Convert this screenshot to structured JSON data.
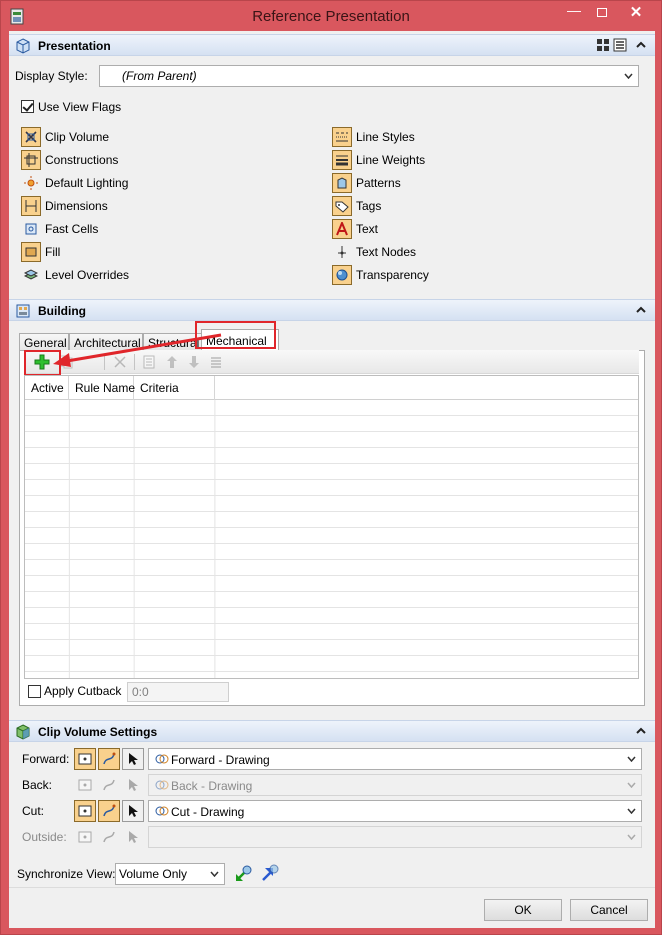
{
  "window": {
    "title": "Reference Presentation"
  },
  "presentation": {
    "title": "Presentation",
    "display_style_label": "Display Style:",
    "display_style_value": "(From Parent)",
    "use_view_flags_label": "Use View Flags",
    "use_view_flags_checked": true,
    "flags_left": [
      {
        "label": "Clip Volume",
        "icon": "clip-volume-icon"
      },
      {
        "label": "Constructions",
        "icon": "constructions-icon"
      },
      {
        "label": "Default Lighting",
        "icon": "default-lighting-icon"
      },
      {
        "label": "Dimensions",
        "icon": "dimensions-icon"
      },
      {
        "label": "Fast Cells",
        "icon": "fast-cells-icon"
      },
      {
        "label": "Fill",
        "icon": "fill-icon"
      },
      {
        "label": "Level Overrides",
        "icon": "level-overrides-icon"
      }
    ],
    "flags_right": [
      {
        "label": "Line Styles",
        "icon": "line-styles-icon"
      },
      {
        "label": "Line Weights",
        "icon": "line-weights-icon"
      },
      {
        "label": "Patterns",
        "icon": "patterns-icon"
      },
      {
        "label": "Tags",
        "icon": "tags-icon"
      },
      {
        "label": "Text",
        "icon": "text-icon"
      },
      {
        "label": "Text Nodes",
        "icon": "text-nodes-icon"
      },
      {
        "label": "Transparency",
        "icon": "transparency-icon"
      }
    ]
  },
  "building": {
    "title": "Building",
    "tabs": [
      {
        "label": "General"
      },
      {
        "label": "Architectural"
      },
      {
        "label": "Structural"
      },
      {
        "label": "Mechanical",
        "active": true
      }
    ],
    "columns": [
      "Active",
      "Rule Name",
      "Criteria"
    ],
    "apply_cutback_label": "Apply Cutback",
    "cutback_value": "0:0"
  },
  "clip_volume": {
    "title": "Clip Volume Settings",
    "rows": [
      {
        "label": "Forward:",
        "value": "Forward - Drawing",
        "enabled": true
      },
      {
        "label": "Back:",
        "value": "Back - Drawing",
        "enabled": false
      },
      {
        "label": "Cut:",
        "value": "Cut - Drawing",
        "enabled": true
      },
      {
        "label": "Outside:",
        "value": "",
        "enabled": false
      }
    ]
  },
  "sync": {
    "label": "Synchronize View:",
    "value": "Volume Only"
  },
  "buttons": {
    "ok": "OK",
    "cancel": "Cancel"
  },
  "colors": {
    "titlebar": "#d9575e",
    "highlight": "#e0262b",
    "section_header": "#d5e1f2",
    "icon_frame": "#f9d18d"
  }
}
